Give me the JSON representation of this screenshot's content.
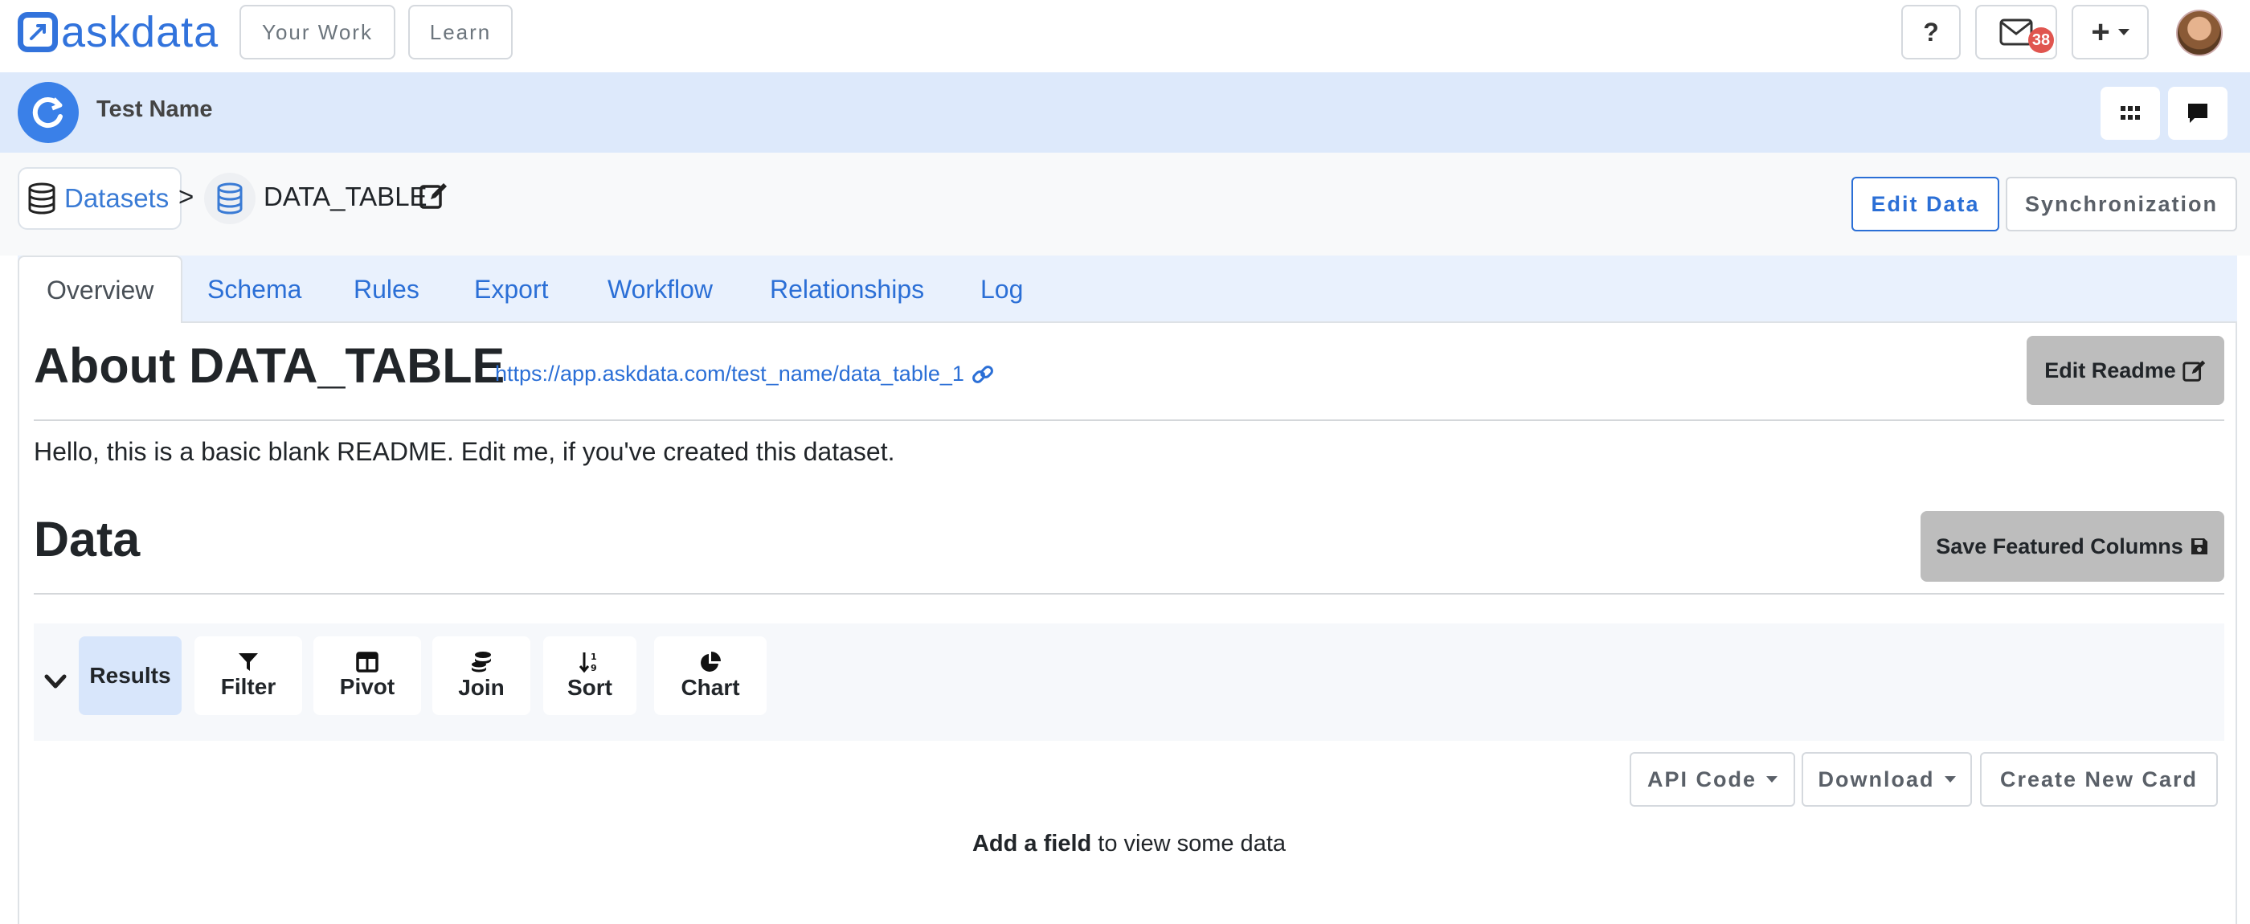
{
  "topnav": {
    "brand": "askdata",
    "your_work_label": "Your Work",
    "learn_label": "Learn",
    "help_label": "?",
    "notifications_count": "38",
    "add_label": "+"
  },
  "project": {
    "name": "Test Name"
  },
  "breadcrumb": {
    "datasets_label": "Datasets",
    "separator": ">",
    "table_name": "DATA_TABLE"
  },
  "actions": {
    "edit_data_label": "Edit Data",
    "synchronization_label": "Synchronization"
  },
  "tabs": [
    {
      "label": "Overview",
      "active": true
    },
    {
      "label": "Schema"
    },
    {
      "label": "Rules"
    },
    {
      "label": "Export"
    },
    {
      "label": "Workflow"
    },
    {
      "label": "Relationships"
    },
    {
      "label": "Log"
    }
  ],
  "about": {
    "title": "About DATA_TABLE",
    "url": "https://app.askdata.com/test_name/data_table_1",
    "edit_readme_label": "Edit Readme",
    "readme_text": "Hello, this is a basic blank README. Edit me, if you've created this dataset."
  },
  "data_section": {
    "title": "Data",
    "save_featured_label": "Save Featured Columns",
    "toolbar": [
      {
        "label": "Results",
        "icon": "none",
        "active": true
      },
      {
        "label": "Filter",
        "icon": "filter-icon"
      },
      {
        "label": "Pivot",
        "icon": "table-columns-icon"
      },
      {
        "label": "Join",
        "icon": "database-stack-icon"
      },
      {
        "label": "Sort",
        "icon": "sort-icon"
      },
      {
        "label": "Chart",
        "icon": "pie-chart-icon"
      }
    ],
    "api_code_label": "API Code",
    "download_label": "Download",
    "create_card_label": "Create New Card",
    "empty_hint_bold": "Add a field",
    "empty_hint_rest": " to view some data"
  },
  "colors": {
    "brand": "#3273dc",
    "project_bar_bg": "#dde9fb",
    "link": "#2b6fd6",
    "grey_button": "#bdbdbd",
    "badge": "#e0554f"
  }
}
